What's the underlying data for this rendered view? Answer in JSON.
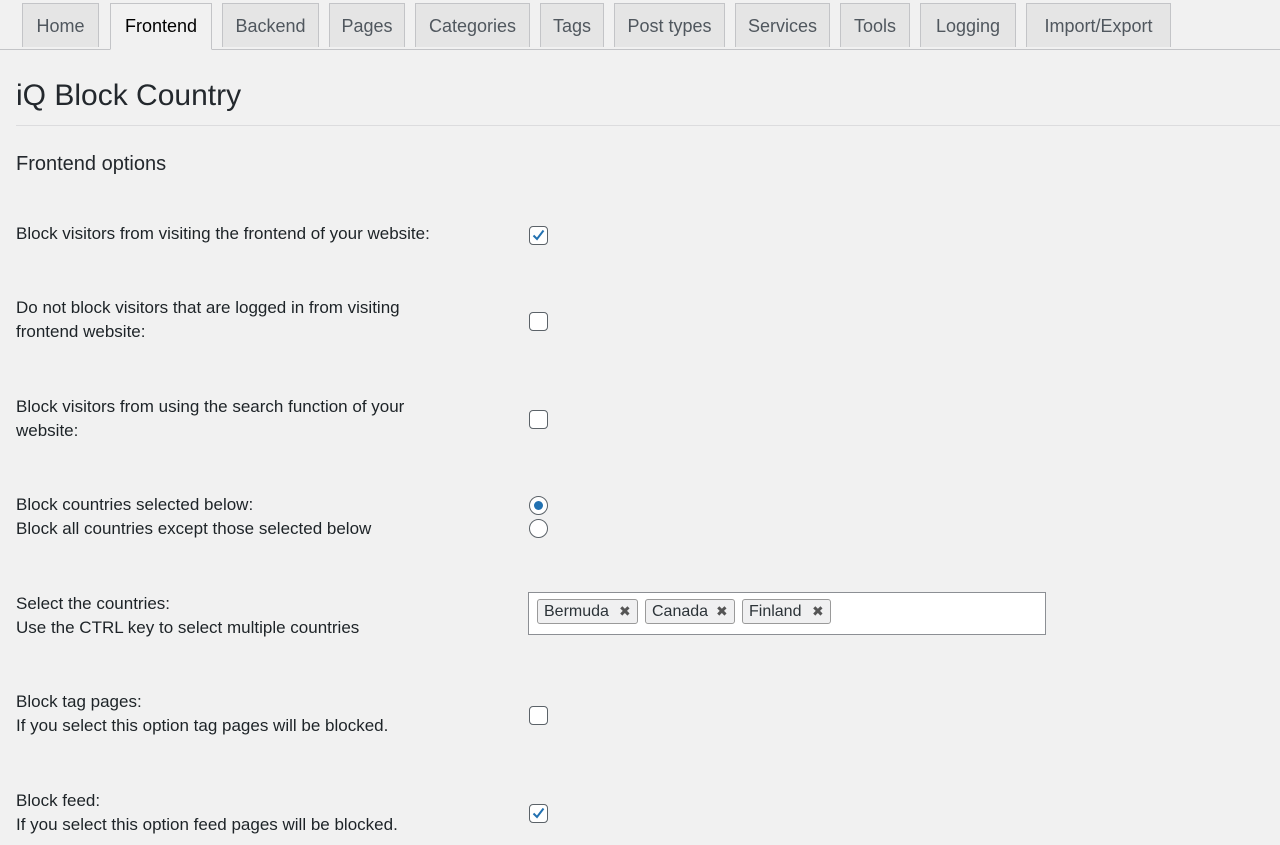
{
  "tabs": [
    {
      "label": "Home",
      "active": false
    },
    {
      "label": "Frontend",
      "active": true
    },
    {
      "label": "Backend",
      "active": false
    },
    {
      "label": "Pages",
      "active": false
    },
    {
      "label": "Categories",
      "active": false
    },
    {
      "label": "Tags",
      "active": false
    },
    {
      "label": "Post types",
      "active": false
    },
    {
      "label": "Services",
      "active": false
    },
    {
      "label": "Tools",
      "active": false
    },
    {
      "label": "Logging",
      "active": false
    },
    {
      "label": "Import/Export",
      "active": false
    }
  ],
  "page_title": "iQ Block Country",
  "section_title": "Frontend options",
  "options": {
    "block_frontend": {
      "label": "Block visitors from visiting the frontend of your website:",
      "checked": true
    },
    "no_block_logged_in": {
      "label_line1": "Do not block visitors that are logged in from visiting",
      "label_line2": "frontend website:",
      "checked": false
    },
    "block_search": {
      "label_line1": "Block visitors from using the search function of your",
      "label_line2": "website:",
      "checked": false
    },
    "block_mode": {
      "option1_label": "Block countries selected below:",
      "option2_label": "Block all countries except those selected below",
      "selected": "option1"
    },
    "countries": {
      "label_line1": "Select the countries:",
      "label_line2": "Use the CTRL key to select multiple countries",
      "selected": [
        "Bermuda",
        "Canada",
        "Finland"
      ],
      "remove_glyph": "✖"
    },
    "block_tag_pages": {
      "label_line1": "Block tag pages:",
      "label_line2": "If you select this option tag pages will be blocked.",
      "checked": false
    },
    "block_feed": {
      "label_line1": "Block feed:",
      "label_line2": "If you select this option feed pages will be blocked.",
      "checked": true
    }
  },
  "colors": {
    "accent": "#2271b1",
    "background": "#f1f1f1"
  }
}
